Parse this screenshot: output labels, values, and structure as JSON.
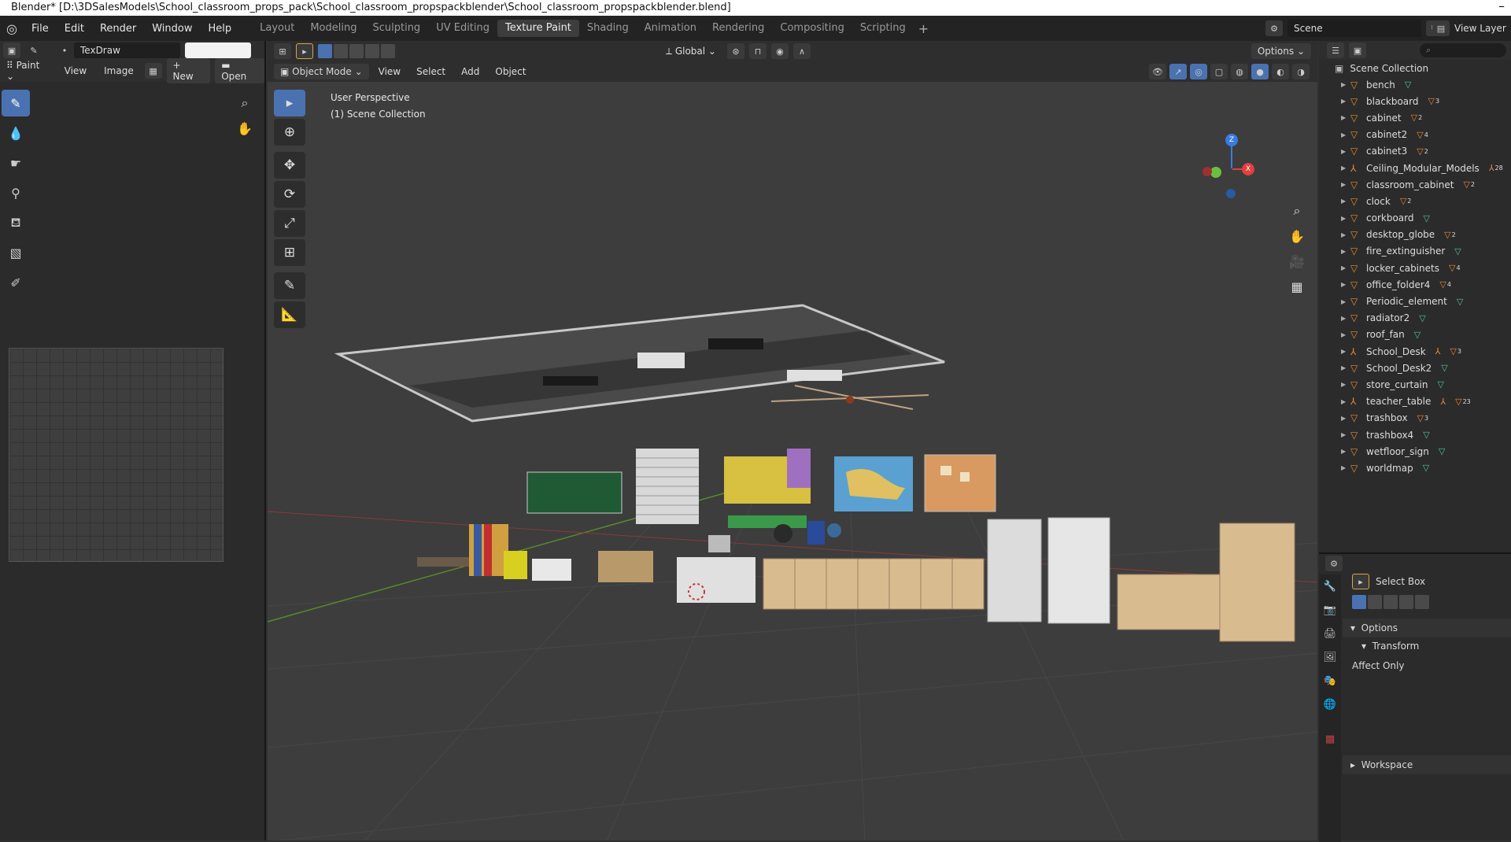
{
  "window": {
    "title": "Blender* [D:\\3DSalesModels\\School_classroom_props_pack\\School_classroom_propspackblender\\School_classroom_propspackblender.blend]"
  },
  "menu": [
    "File",
    "Edit",
    "Render",
    "Window",
    "Help"
  ],
  "workspaces": [
    {
      "label": "Layout",
      "active": false
    },
    {
      "label": "Modeling",
      "active": false
    },
    {
      "label": "Sculpting",
      "active": false
    },
    {
      "label": "UV Editing",
      "active": false
    },
    {
      "label": "Texture Paint",
      "active": true
    },
    {
      "label": "Shading",
      "active": false
    },
    {
      "label": "Animation",
      "active": false
    },
    {
      "label": "Rendering",
      "active": false
    },
    {
      "label": "Compositing",
      "active": false
    },
    {
      "label": "Scripting",
      "active": false
    }
  ],
  "scene": {
    "name": "Scene",
    "view_layer": "View Layer"
  },
  "image_editor": {
    "brush_name": "TexDraw",
    "mode_label": "Paint",
    "view_label": "View",
    "image_label": "Image",
    "new_label": "New",
    "open_label": "Open"
  },
  "viewport": {
    "mode": "Object Mode",
    "menus": [
      "View",
      "Select",
      "Add",
      "Object"
    ],
    "orientation": "Global",
    "options_label": "Options",
    "perspective_text": "User Perspective",
    "collection_text": "(1) Scene Collection",
    "gizmo": {
      "z": "Z",
      "x": "X"
    }
  },
  "outliner": {
    "root": "Scene Collection",
    "items": [
      {
        "name": "bench",
        "arm": false,
        "mesh": "teal",
        "count": ""
      },
      {
        "name": "blackboard",
        "arm": false,
        "mesh": "orange",
        "count": "3"
      },
      {
        "name": "cabinet",
        "arm": false,
        "mesh": "orange",
        "count": "2"
      },
      {
        "name": "cabinet2",
        "arm": false,
        "mesh": "orange",
        "count": "4"
      },
      {
        "name": "cabinet3",
        "arm": false,
        "mesh": "orange",
        "count": "2"
      },
      {
        "name": "Ceiling_Modular_Models",
        "arm": true,
        "mesh": "",
        "count": "28"
      },
      {
        "name": "classroom_cabinet",
        "arm": false,
        "mesh": "orange",
        "count": "2"
      },
      {
        "name": "clock",
        "arm": false,
        "mesh": "orange",
        "count": "2"
      },
      {
        "name": "corkboard",
        "arm": false,
        "mesh": "teal",
        "count": ""
      },
      {
        "name": "desktop_globe",
        "arm": false,
        "mesh": "orange",
        "count": "2"
      },
      {
        "name": "fire_extinguisher",
        "arm": false,
        "mesh": "teal",
        "count": ""
      },
      {
        "name": "locker_cabinets",
        "arm": false,
        "mesh": "orange",
        "count": "4"
      },
      {
        "name": "office_folder4",
        "arm": false,
        "mesh": "orange",
        "count": "4"
      },
      {
        "name": "Periodic_element",
        "arm": false,
        "mesh": "teal",
        "count": ""
      },
      {
        "name": "radiator2",
        "arm": false,
        "mesh": "teal",
        "count": ""
      },
      {
        "name": "roof_fan",
        "arm": false,
        "mesh": "teal",
        "count": ""
      },
      {
        "name": "School_Desk",
        "arm": true,
        "mesh": "orange",
        "count": "3"
      },
      {
        "name": "School_Desk2",
        "arm": false,
        "mesh": "teal",
        "count": ""
      },
      {
        "name": "store_curtain",
        "arm": false,
        "mesh": "teal",
        "count": ""
      },
      {
        "name": "teacher_table",
        "arm": true,
        "mesh": "orange",
        "count": "23"
      },
      {
        "name": "trashbox",
        "arm": false,
        "mesh": "orange",
        "count": "3"
      },
      {
        "name": "trashbox4",
        "arm": false,
        "mesh": "teal",
        "count": ""
      },
      {
        "name": "wetfloor_sign",
        "arm": false,
        "mesh": "teal",
        "count": ""
      },
      {
        "name": "worldmap",
        "arm": false,
        "mesh": "teal",
        "count": ""
      }
    ]
  },
  "properties": {
    "tool_name": "Select Box",
    "options_label": "Options",
    "transform_label": "Transform",
    "affect_only_label": "Affect Only",
    "workspace_label": "Workspace"
  },
  "colors": {
    "accent": "#4a72b0",
    "mesh_teal": "#4fc3a1",
    "object_orange": "#e38b3a"
  }
}
